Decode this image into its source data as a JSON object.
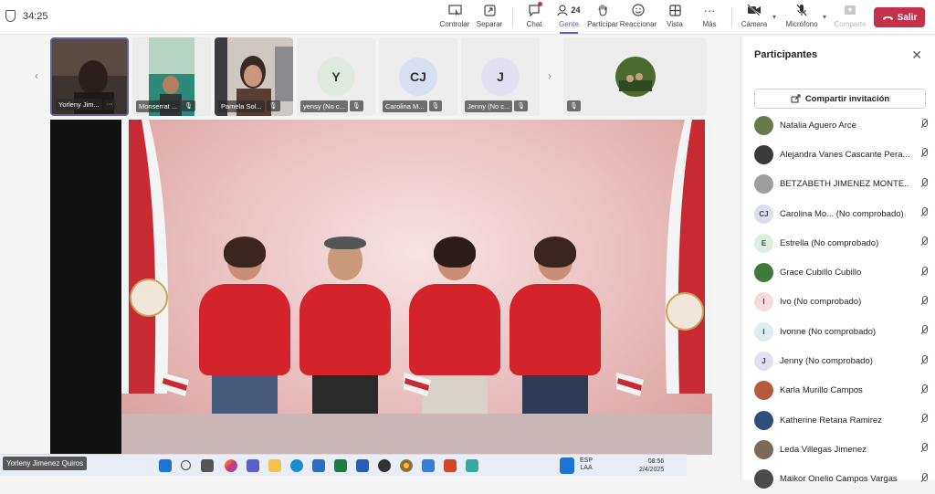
{
  "header": {
    "timer": "34:25",
    "controls": [
      {
        "name": "control",
        "label": "Controlar"
      },
      {
        "name": "popout",
        "label": "Separar"
      },
      {
        "name": "chat",
        "label": "Chat"
      },
      {
        "name": "people",
        "label": "Gente",
        "count": "24"
      },
      {
        "name": "raise-hand",
        "label": "Participar"
      },
      {
        "name": "react",
        "label": "Reaccionar"
      },
      {
        "name": "view",
        "label": "Vista"
      },
      {
        "name": "more",
        "label": "Más"
      },
      {
        "name": "camera",
        "label": "Cámara"
      },
      {
        "name": "mic",
        "label": "Micrófono"
      },
      {
        "name": "share",
        "label": "Comparte"
      }
    ],
    "leave_label": "Salir"
  },
  "thumbnails": [
    {
      "name": "Yorleny Jim...",
      "extra": "···"
    },
    {
      "name": "Monserrat ..."
    },
    {
      "name": "Pamela Sol..."
    },
    {
      "name": "yensy (No c...",
      "initials": "Y",
      "color": "#dfeadf"
    },
    {
      "name": "Carolina M...",
      "initials": "CJ",
      "color": "#d7dff0"
    },
    {
      "name": "Jenny (No c...",
      "initials": "J",
      "color": "#e3dff2"
    },
    {
      "name": ""
    }
  ],
  "stage": {
    "presenter_tag": "Yorleny Jimenez Quiros",
    "taskbar": {
      "lang_line1": "ESP",
      "lang_line2": "LAA",
      "time": "08:56",
      "date": "2/4/2025"
    }
  },
  "panel": {
    "title": "Participantes",
    "invite_label": "Compartir invitación",
    "participants": [
      {
        "name": "Natalia Aguero Arce",
        "initials": "",
        "color": "#6b7a4d"
      },
      {
        "name": "Alejandra Vanes Cascante Pera...",
        "initials": "",
        "color": "#3a3a3a"
      },
      {
        "name": "BETZABETH JIMENEZ MONTE...",
        "initials": "",
        "color": "#9e9e9e"
      },
      {
        "name": "Carolina Mo... (No comprobado)",
        "initials": "CJ",
        "color": "#d7dff0"
      },
      {
        "name": "Estrella (No comprobado)",
        "initials": "E",
        "color": "#dcefdc"
      },
      {
        "name": "Grace Cubillo Cubillo",
        "initials": "",
        "color": "#3f7a3a"
      },
      {
        "name": "Ivo (No comprobado)",
        "initials": "I",
        "color": "#f6dcdc"
      },
      {
        "name": "Ivonne (No comprobado)",
        "initials": "I",
        "color": "#dceef2"
      },
      {
        "name": "Jenny (No comprobado)",
        "initials": "J",
        "color": "#e3dff2"
      },
      {
        "name": "Karla Murillo Campos",
        "initials": "",
        "color": "#b55a3a"
      },
      {
        "name": "Katherine Retana Ramirez",
        "initials": "",
        "color": "#2d4f7a"
      },
      {
        "name": "Leda Villegas Jimenez",
        "initials": "",
        "color": "#7a6a5a"
      },
      {
        "name": "Maikor Onelio Campos Vargas",
        "initials": "",
        "color": "#4a4a4a"
      }
    ]
  }
}
